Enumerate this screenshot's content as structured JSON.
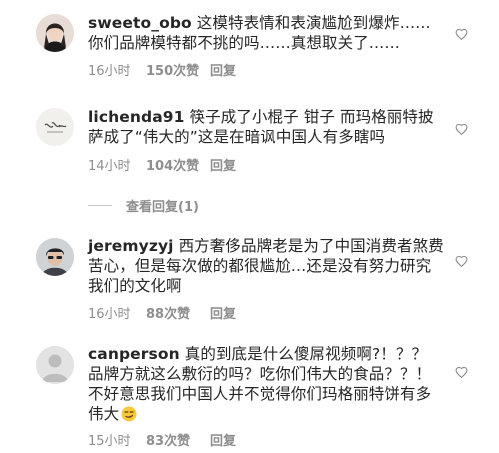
{
  "comments": [
    {
      "username": "sweeto_obo",
      "body": "这模特表情和表演尴尬到爆炸……你们品牌模特都不挑的吗……真想取关了……",
      "time": "16小时",
      "likes": "150次赞",
      "reply": "回复"
    },
    {
      "username": "lichenda91",
      "body": "筷子成了小棍子 钳子 而玛格丽特披萨成了“伟大的”这是在暗讽中国人有多瞎吗",
      "time": "14小时",
      "likes": "104次赞",
      "reply": "回复"
    },
    {
      "username": "jeremyzyj",
      "body": "西方奢侈品牌老是为了中国消费者煞费苦心，但是每次做的都很尴尬…还是没有努力研究我们的文化啊",
      "time": "16小时",
      "likes": "88次赞",
      "reply": "回复"
    },
    {
      "username": "canperson",
      "body": "真的到底是什么傻屌视频啊?！？？ 品牌方就这么敷衍的吗？吃你们伟大的食品？？！不好意思我们中国人并不觉得你们玛格丽特饼有多伟大",
      "time": "15小时",
      "likes": "83次赞",
      "reply": "回复"
    }
  ],
  "view_replies": "查看回复(1)",
  "colors": {
    "text": "#262626",
    "meta": "#8e8e8e",
    "heart": "#8e8e8e"
  }
}
